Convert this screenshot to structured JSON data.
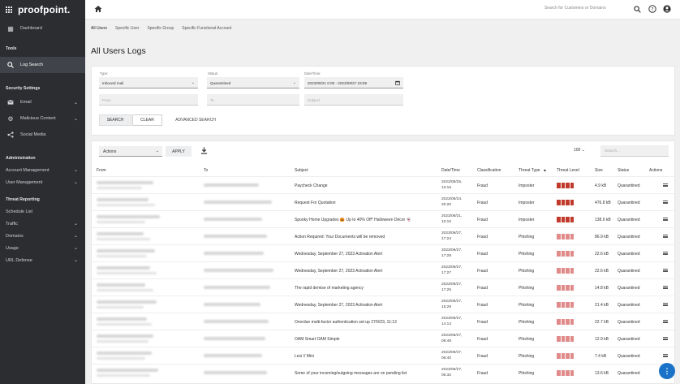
{
  "brand": {
    "name": "proofpoint."
  },
  "sidebar": {
    "dashboard": "Dashboard",
    "tools_section": "Tools",
    "log_search": "Log Search",
    "security_section": "Security Settings",
    "email": "Email",
    "malicious_content": "Malicious Content",
    "social_media": "Social Media",
    "admin_section": "Administration",
    "account_management": "Account Management",
    "user_management": "User Management",
    "threat_section": "Threat Reporting",
    "schedule_list": "Schedule List",
    "traffic": "Traffic",
    "domains": "Domains",
    "usage": "Usage",
    "url_defense": "URL Defense"
  },
  "topbar": {
    "search_placeholder": "Search for Customers or Domains"
  },
  "tabs": [
    "All Users",
    "Specific User",
    "Specific Group",
    "Specific Functional Account"
  ],
  "page": {
    "title": "All Users Logs"
  },
  "search": {
    "type_label": "Type:",
    "type_value": "Inbound mail",
    "status_label": "Status:",
    "status_value": "Quarantined",
    "datetime_label": "Date/Time:",
    "datetime_value": "2023/09/21 0:00 - 2023/09/27 23:59",
    "from_placeholder": "From",
    "to_placeholder": "To",
    "subject_placeholder": "Subject",
    "search_btn": "SEARCH",
    "clear_btn": "CLEAR",
    "advanced_btn": "ADVANCED SEARCH"
  },
  "results": {
    "actions_label": "Actions",
    "apply_btn": "APPLY",
    "page_size": "100",
    "search_placeholder": "Search...",
    "columns": {
      "from": "From",
      "to": "To",
      "subject": "Subject",
      "datetime": "Date/Time",
      "classification": "Classification",
      "threat_type": "Threat Type",
      "threat_level": "Threat Level",
      "size": "Size",
      "status": "Status",
      "actions": "Actions"
    },
    "rows": [
      {
        "subject": "Paycheck Change",
        "date": "2023/09/25,",
        "time": "13:16",
        "classification": "Fraud",
        "threat_type": "Imposter",
        "level": 4,
        "color": "#c0392b",
        "size": "4.9 kB",
        "status": "Quarantined"
      },
      {
        "subject": "Request For Quotation",
        "date": "2023/09/24,",
        "time": "20:20",
        "classification": "Fraud",
        "threat_type": "Imposter",
        "level": 4,
        "color": "#c0392b",
        "size": "476.8 kB",
        "status": "Quarantined"
      },
      {
        "subject": "Spooky Home Upgrades 🎃 Up to 40% Off* Halloween Décor 👻",
        "date": "2023/09/21,",
        "time": "10:10",
        "classification": "Fraud",
        "threat_type": "Imposter",
        "level": 4,
        "color": "#c0392b",
        "size": "138.6 kB",
        "status": "Quarantined"
      },
      {
        "subject": "Action Required: Your Documents will be removed",
        "date": "2023/09/27,",
        "time": "17:24",
        "classification": "Fraud",
        "threat_type": "Phishing",
        "level": 4,
        "color": "#e08a8a",
        "size": "86.9 kB",
        "status": "Quarantined"
      },
      {
        "subject": "Wednesday, September 27, 2023 Activation Alert",
        "date": "2023/09/27,",
        "time": "17:28",
        "classification": "Fraud",
        "threat_type": "Phishing",
        "level": 4,
        "color": "#e08a8a",
        "size": "22.6 kB",
        "status": "Quarantined"
      },
      {
        "subject": "Wednesday, September 27, 2023 Activation Alert",
        "date": "2023/09/27,",
        "time": "17:27",
        "classification": "Fraud",
        "threat_type": "Phishing",
        "level": 4,
        "color": "#e08a8a",
        "size": "22.6 kB",
        "status": "Quarantined"
      },
      {
        "subject": "The rapid demise of marketing agency",
        "date": "2023/09/27,",
        "time": "17:25",
        "classification": "Fraud",
        "threat_type": "Phishing",
        "level": 4,
        "color": "#e08a8a",
        "size": "14.8 kB",
        "status": "Quarantined"
      },
      {
        "subject": "Wednesday, September 27, 2023 Activation Alert",
        "date": "2023/09/27,",
        "time": "15:29",
        "classification": "Fraud",
        "threat_type": "Phishing",
        "level": 4,
        "color": "#e08a8a",
        "size": "21.4 kB",
        "status": "Quarantined"
      },
      {
        "subject": "Overdue multi-factor authentication set up 27/9/23, 11:13",
        "date": "2023/09/27,",
        "time": "14:14",
        "classification": "Fraud",
        "threat_type": "Phishing",
        "level": 4,
        "color": "#e08a8a",
        "size": "22.7 kB",
        "status": "Quarantined"
      },
      {
        "subject": "OAM Smart OAM Simple",
        "date": "2023/09/27,",
        "time": "09:49",
        "classification": "Fraud",
        "threat_type": "Phishing",
        "level": 4,
        "color": "#e08a8a",
        "size": "12.9 kB",
        "status": "Quarantined"
      },
      {
        "subject": "Lexi // Mini",
        "date": "2023/09/27,",
        "time": "06:40",
        "classification": "Fraud",
        "threat_type": "Phishing",
        "level": 4,
        "color": "#e08a8a",
        "size": "7.4 kB",
        "status": "Quarantined"
      },
      {
        "subject": "Some of your incoming/outgoing messages are on pending list",
        "date": "2023/09/27,",
        "time": "05:32",
        "classification": "Fraud",
        "threat_type": "Phishing",
        "level": 4,
        "color": "#e08a8a",
        "size": "13.6 kB",
        "status": "Quarantined"
      }
    ]
  }
}
